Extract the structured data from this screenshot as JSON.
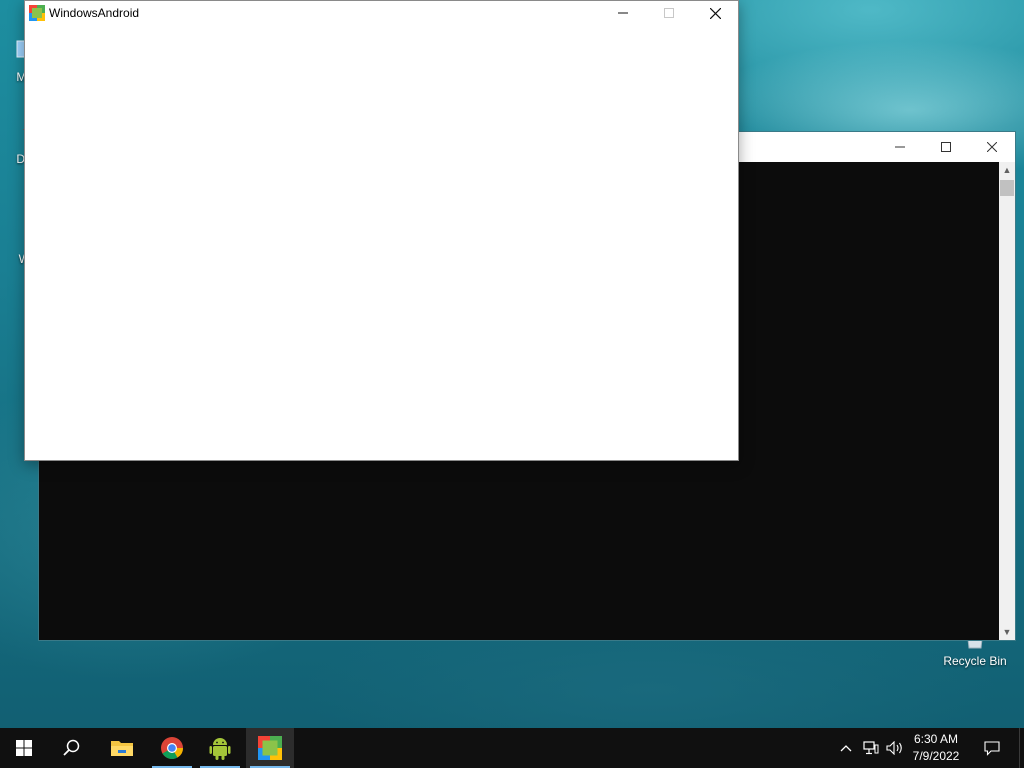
{
  "desktop": {
    "icons": [
      {
        "label": "My c",
        "icon": "computer-icon"
      },
      {
        "label": "Data",
        "icon": "database-shortcut-icon"
      },
      {
        "label": "Win",
        "icon": "windowsandroid-shortcut-icon"
      },
      {
        "label": "Recycle Bin",
        "icon": "recycle-bin-icon"
      }
    ]
  },
  "app_window": {
    "title": "WindowsAndroid",
    "icon": "windowsandroid-app-icon",
    "buttons": {
      "minimize": "minimize-icon",
      "maximize": "maximize-icon",
      "close": "close-icon"
    }
  },
  "console_window": {
    "background_color": "#0c0c0c",
    "buttons": {
      "minimize": "minimize-icon",
      "maximize": "maximize-icon",
      "close": "close-icon"
    }
  },
  "taskbar": {
    "items": [
      {
        "name": "start",
        "icon": "windows-start-icon"
      },
      {
        "name": "search",
        "icon": "search-icon"
      },
      {
        "name": "file-explorer",
        "icon": "folder-icon"
      },
      {
        "name": "chrome",
        "icon": "chrome-icon"
      },
      {
        "name": "android",
        "icon": "android-icon"
      },
      {
        "name": "windowsandroid",
        "icon": "windowsandroid-app-icon"
      }
    ],
    "tray": {
      "time": "6:30 AM",
      "date": "7/9/2022",
      "icons": [
        "chevron-up-icon",
        "network-icon",
        "volume-icon",
        "notification-icon"
      ]
    },
    "accent_color": "#76b9ed"
  }
}
